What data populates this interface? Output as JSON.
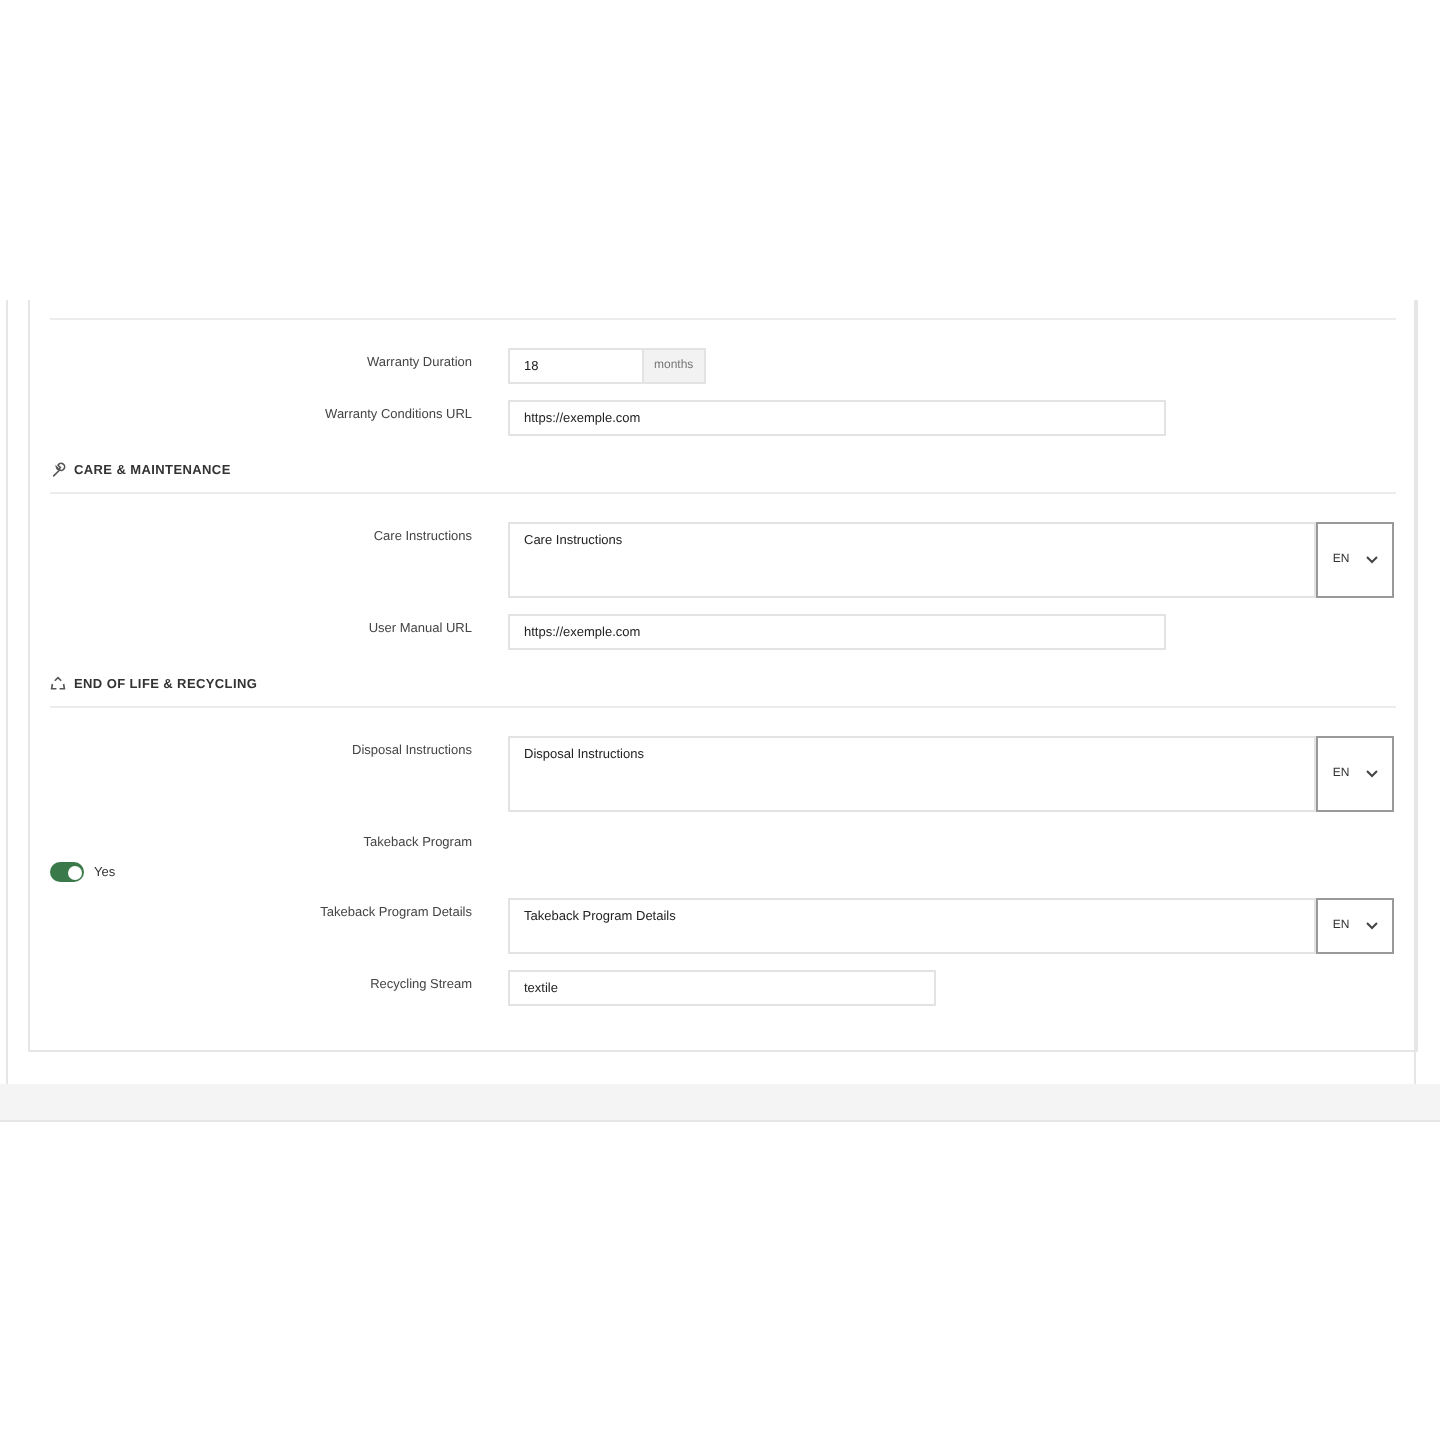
{
  "sections": [
    {
      "fields": [
        {
          "kind": "input_addon",
          "label": "Warranty Duration",
          "value": "18",
          "addon": "months"
        },
        {
          "kind": "input",
          "label": "Warranty Conditions URL",
          "value": "https://exemple.com"
        }
      ]
    },
    {
      "title": "CARE & MAINTENANCE",
      "fields": [
        {
          "kind": "textarea_lang",
          "label": "Care Instructions",
          "value": "Care Instructions",
          "lang": "EN"
        },
        {
          "kind": "input",
          "label": "User Manual URL",
          "value": "https://exemple.com"
        }
      ]
    },
    {
      "title": "END OF LIFE & RECYCLING",
      "fields": [
        {
          "kind": "textarea_lang",
          "label": "Disposal Instructions",
          "value": "Disposal Instructions",
          "lang": "EN"
        },
        {
          "kind": "toggle",
          "label": "Takeback Program",
          "on": true,
          "text": "Yes"
        },
        {
          "kind": "textarea_lang",
          "label": "Takeback Program Details",
          "value": "Takeback Program Details",
          "lang": "EN"
        },
        {
          "kind": "input",
          "label": "Recycling Stream",
          "value": "textile"
        }
      ]
    }
  ]
}
